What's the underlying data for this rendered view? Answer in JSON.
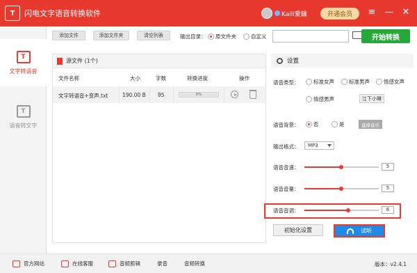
{
  "window": {
    "logo_text": "T",
    "title": "闪电文字语音转换软件",
    "user_name": "Kaili爱鑰",
    "vip_label": "开通会员",
    "menu_icon": "≡",
    "minimize_icon": "—",
    "close_icon": "✕"
  },
  "sidebar": {
    "items": [
      {
        "label": "文字转语音",
        "icon": "text-to-speech-icon",
        "icon_glyph": "T"
      },
      {
        "label": "语音转文字",
        "icon": "speech-to-text-icon",
        "icon_glyph": "T"
      }
    ]
  },
  "toolbar": {
    "add_file": "添加文件",
    "add_folder": "添加文件夹",
    "clear_list": "清空列表",
    "output_label": "输出目录：",
    "output_options": [
      "原文件夹",
      "自定义"
    ],
    "output_selected": "原文件夹",
    "path_value": "",
    "start_button": "开始转换"
  },
  "file_panel": {
    "header": "源文件 (1个)",
    "columns": [
      "文件名称",
      "大小",
      "字数",
      "转换进度",
      "操作"
    ],
    "rows": [
      {
        "name": "文字转语音+变声.txt",
        "size": "190.00 B",
        "words": "95",
        "progress": "0%"
      }
    ]
  },
  "settings": {
    "header": "设置",
    "voice_type_label": "语音类型：",
    "voice_types": [
      "标准女声",
      "标准男声",
      "情感女声",
      "情感男声"
    ],
    "voice_extra": "江下小琳",
    "bg_label": "语音背景：",
    "bg_options": [
      "否",
      "是"
    ],
    "bg_selected": "否",
    "choose_music": "选择音乐",
    "format_label": "输出格式：",
    "format_value": "MP3",
    "speed_label": "语音音速：",
    "speed_value": "5",
    "volume_label": "语音音量：",
    "volume_value": "5",
    "pitch_label": "语音音调：",
    "pitch_value": "6",
    "reset_button": "初始化设置",
    "listen_button": "试听"
  },
  "bottom_bar": {
    "items": [
      "官方网站",
      "在线客服",
      "音频剪辑",
      "录音",
      "音频转换"
    ],
    "version": "版本：v2.4.1"
  },
  "colors": {
    "brand_red": "#e8392f",
    "start_green": "#26a93a",
    "listen_blue": "#1f8be6"
  }
}
